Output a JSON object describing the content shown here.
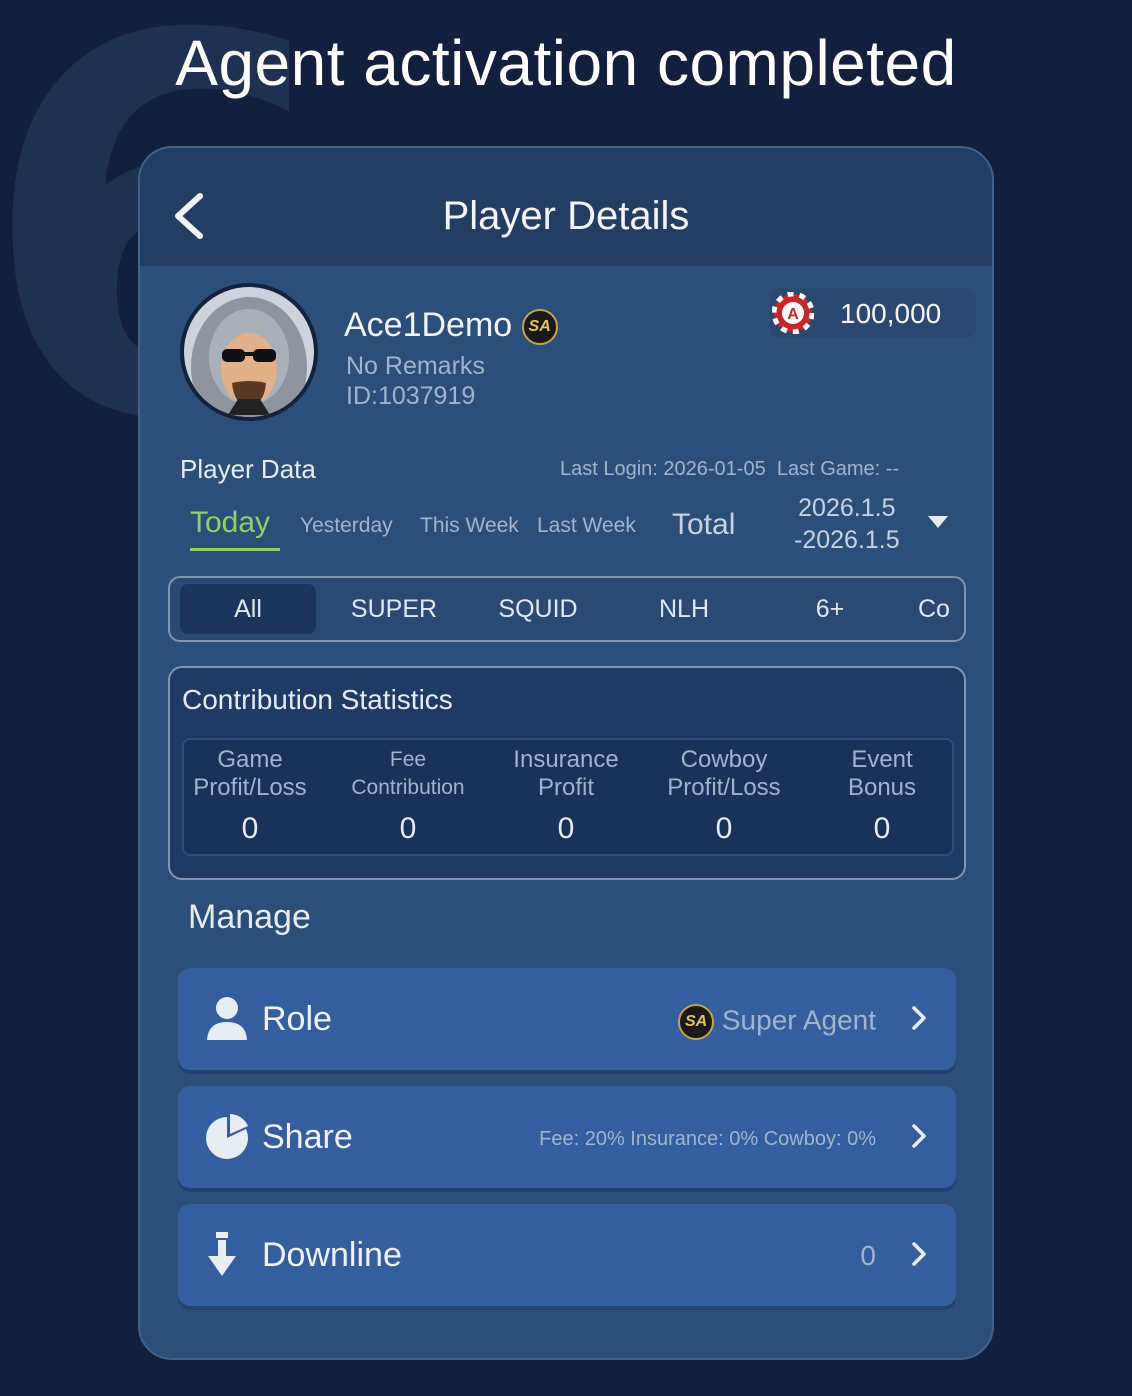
{
  "headline": "Agent activation completed",
  "step_number": "6",
  "header": {
    "title": "Player Details"
  },
  "player": {
    "name": "Ace1Demo",
    "badge": "SA",
    "remarks": "No Remarks",
    "id": "ID:1037919",
    "coins": "100,000"
  },
  "player_data": {
    "label": "Player Data",
    "last_login": "Last Login: 2026-01-05",
    "last_game": "Last Game: --",
    "periods": [
      "Today",
      "Yesterday",
      "This Week",
      "Last Week",
      "Total"
    ],
    "range_start": "2026.1.5",
    "range_end": "-2026.1.5"
  },
  "game_tabs": [
    "All",
    "SUPER",
    "SQUID",
    "NLH",
    "6+",
    "Co"
  ],
  "stats": {
    "title": "Contribution Statistics",
    "items": [
      {
        "label1": "Game",
        "label2": "Profit/Loss",
        "value": "0"
      },
      {
        "label1": "Fee",
        "label2": "Contribution",
        "value": "0"
      },
      {
        "label1": "Insurance",
        "label2": "Profit",
        "value": "0"
      },
      {
        "label1": "Cowboy",
        "label2": "Profit/Loss",
        "value": "0"
      },
      {
        "label1": "Event",
        "label2": "Bonus",
        "value": "0"
      }
    ]
  },
  "manage": {
    "title": "Manage",
    "rows": [
      {
        "label": "Role",
        "badge": "SA",
        "value": "Super Agent",
        "icon": "user-icon"
      },
      {
        "label": "Share",
        "value": "Fee: 20% Insurance: 0% Cowboy: 0%",
        "icon": "pie-chart-icon"
      },
      {
        "label": "Downline",
        "value": "0",
        "icon": "download-arrow-icon"
      }
    ]
  },
  "colors": {
    "accent_green": "#8ed06b",
    "background": "#12203d",
    "panel": "#2c4f79"
  }
}
